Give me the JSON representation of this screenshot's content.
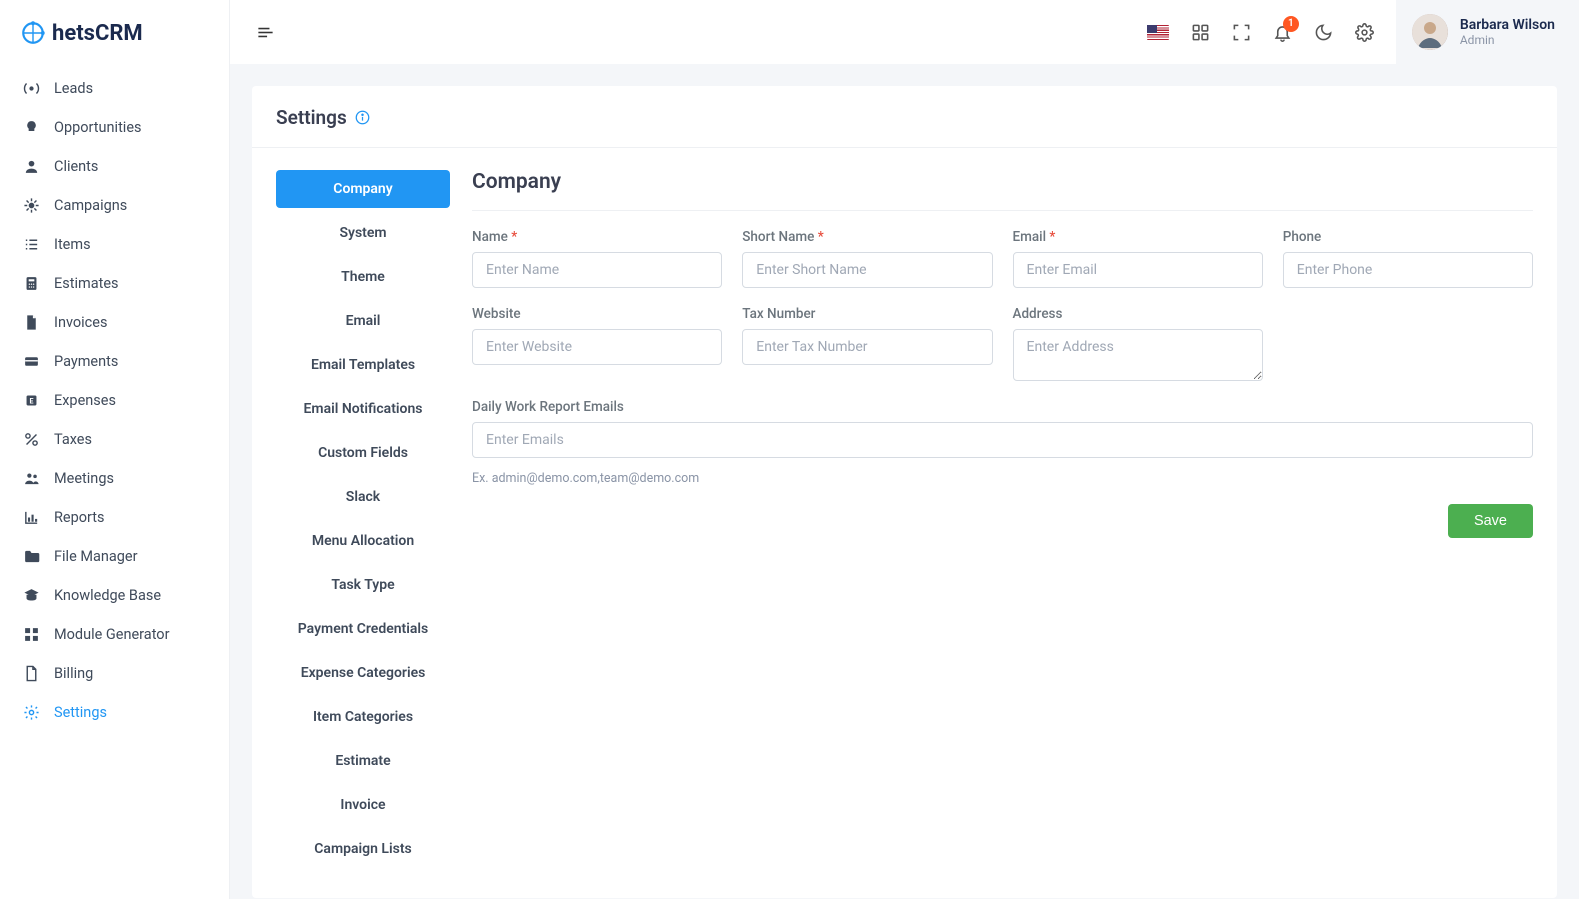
{
  "brand": "hetsCRM",
  "sidebar": {
    "items": [
      {
        "label": "Leads",
        "icon": "radio"
      },
      {
        "label": "Opportunities",
        "icon": "bulb"
      },
      {
        "label": "Clients",
        "icon": "user"
      },
      {
        "label": "Campaigns",
        "icon": "virus"
      },
      {
        "label": "Items",
        "icon": "list"
      },
      {
        "label": "Estimates",
        "icon": "calc"
      },
      {
        "label": "Invoices",
        "icon": "file"
      },
      {
        "label": "Payments",
        "icon": "card"
      },
      {
        "label": "Expenses",
        "icon": "eicon"
      },
      {
        "label": "Taxes",
        "icon": "percent"
      },
      {
        "label": "Meetings",
        "icon": "group"
      },
      {
        "label": "Reports",
        "icon": "chart"
      },
      {
        "label": "File Manager",
        "icon": "folder"
      },
      {
        "label": "Knowledge Base",
        "icon": "grad"
      },
      {
        "label": "Module Generator",
        "icon": "grid"
      },
      {
        "label": "Billing",
        "icon": "doc"
      },
      {
        "label": "Settings",
        "icon": "gear",
        "active": true
      }
    ]
  },
  "header": {
    "notification_count": "1",
    "user": {
      "name": "Barbara Wilson",
      "role": "Admin"
    }
  },
  "page": {
    "title": "Settings",
    "tabs": [
      "Company",
      "System",
      "Theme",
      "Email",
      "Email Templates",
      "Email Notifications",
      "Custom Fields",
      "Slack",
      "Menu Allocation",
      "Task Type",
      "Payment Credentials",
      "Expense Categories",
      "Item Categories",
      "Estimate",
      "Invoice",
      "Campaign Lists"
    ],
    "active_tab": "Company",
    "form": {
      "title": "Company",
      "fields": {
        "name": {
          "label": "Name",
          "required": true,
          "placeholder": "Enter Name"
        },
        "short_name": {
          "label": "Short Name",
          "required": true,
          "placeholder": "Enter Short Name"
        },
        "email": {
          "label": "Email",
          "required": true,
          "placeholder": "Enter Email"
        },
        "phone": {
          "label": "Phone",
          "required": false,
          "placeholder": "Enter Phone"
        },
        "website": {
          "label": "Website",
          "required": false,
          "placeholder": "Enter Website"
        },
        "tax_number": {
          "label": "Tax Number",
          "required": false,
          "placeholder": "Enter Tax Number"
        },
        "address": {
          "label": "Address",
          "required": false,
          "placeholder": "Enter Address"
        },
        "emails": {
          "label": "Daily Work Report Emails",
          "placeholder": "Enter Emails",
          "hint": "Ex. admin@demo.com,team@demo.com"
        }
      },
      "save_label": "Save"
    }
  }
}
